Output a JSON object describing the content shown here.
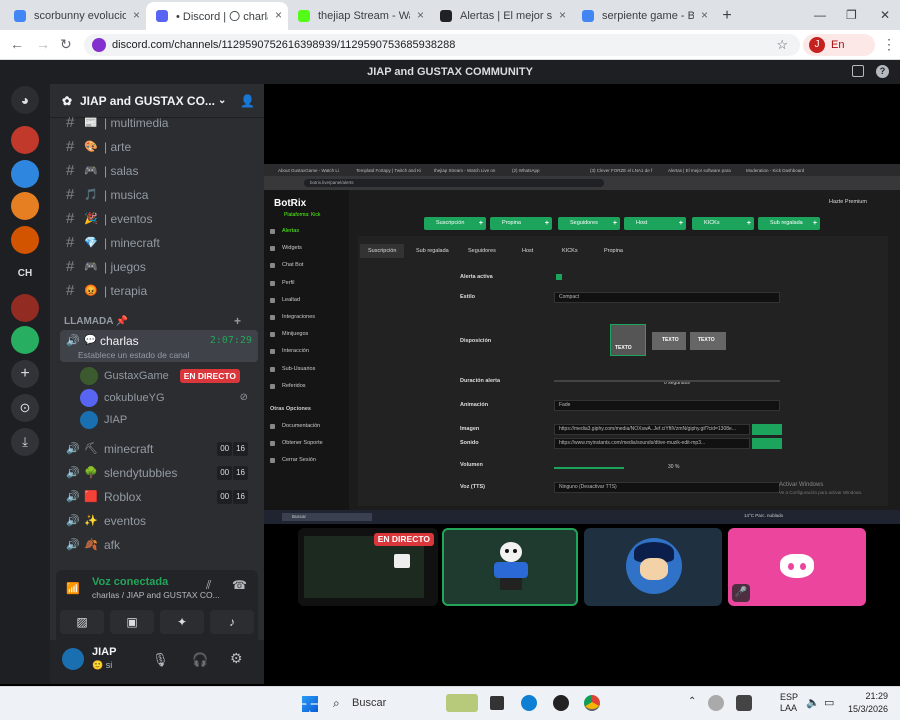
{
  "browser": {
    "tabs": [
      {
        "label": "scorbunny evolucion - Bu",
        "color": "#4285f4",
        "active": false
      },
      {
        "label": "• Discord | 〇 charlas |",
        "color": "#5865f2",
        "active": true
      },
      {
        "label": "thejiap Stream - Watch Li",
        "color": "#53fc18",
        "active": false
      },
      {
        "label": "Alertas | El mejor softwar",
        "color": "#202124",
        "active": false
      },
      {
        "label": "serpiente game - Buscar",
        "color": "#4285f4",
        "active": false
      }
    ],
    "url": "discord.com/channels/1129590752616398939/1129590753685938288",
    "profile_initial": "J",
    "profile_status": "En pausa"
  },
  "discord": {
    "window_title": "JIAP and GUSTAX COMMUNITY",
    "server_name": "JIAP and GUSTAX CO...",
    "text_channels": [
      {
        "emoji": "📰",
        "name": "| multimedia"
      },
      {
        "emoji": "🎨",
        "name": "| arte"
      },
      {
        "emoji": "🎮",
        "name": "| salas"
      },
      {
        "emoji": "🎵",
        "name": "| musica"
      },
      {
        "emoji": "🎉",
        "name": "| eventos"
      },
      {
        "emoji": "💎",
        "name": "| minecraft"
      },
      {
        "emoji": "🎮",
        "name": "| juegos"
      },
      {
        "emoji": "😡",
        "name": "| terapia"
      }
    ],
    "category": "LLAMADA 📌",
    "active_voice": {
      "name": "charlas",
      "time": "2:07:29",
      "status_placeholder": "Establece un estado de canal"
    },
    "voice_users": [
      {
        "name": "GustaxGame",
        "badge": "EN DIRECTO",
        "avatar_color": "#3b5b2e"
      },
      {
        "name": "cokubIueYG",
        "badge": "",
        "avatar_color": "#5865f2"
      },
      {
        "name": "JIAP",
        "badge": "",
        "avatar_color": "#1a6fb0"
      }
    ],
    "voice_channels": [
      {
        "emoji": "⛏",
        "name": "minecraft",
        "count": [
          "00",
          "16"
        ]
      },
      {
        "emoji": "🌳",
        "name": "slendytubbies",
        "count": [
          "00",
          "16"
        ]
      },
      {
        "emoji": "🟥",
        "name": "Roblox",
        "count": [
          "00",
          "16"
        ]
      },
      {
        "emoji": "✨",
        "name": "eventos",
        "count": []
      },
      {
        "emoji": "🍂",
        "name": "afk",
        "count": []
      }
    ],
    "voice_panel": {
      "status": "Voz conectada",
      "channel": "charlas / JIAP and GUSTAX CO..."
    },
    "user": {
      "name": "JIAP",
      "status": "si"
    },
    "participant_badge": "EN DIRECTO"
  },
  "shared_screen": {
    "tabs": [
      "About GustaxGame - Watch Li",
      "Templatd Fortapy | Twitch and Ki",
      "thejiap Stream - Watch Live on",
      "(2) WhatsApp",
      "(3) Clever FORZE el LNA1 de f",
      "Alertas | El mejor software para",
      "Moderation - Kick Dashboard"
    ],
    "url": "botrix.live/panel/alerts",
    "brand": "BotRix",
    "platform": "Plataforma: Kick",
    "premium": "Hazte Premium",
    "sidebar": [
      "Alertas",
      "Widgets",
      "Chat Bot",
      "Perfil",
      "Lealtad",
      "Integraciones",
      "Minijuegos",
      "Interacción",
      "Sub-Usuarios",
      "Referidos"
    ],
    "sidebar_other_title": "Otras Opciones",
    "sidebar_other": [
      "Documentación",
      "Obtener Soporte",
      "Cerrar Sesión"
    ],
    "green_buttons": [
      "Suscripción",
      "Propina",
      "Seguidores",
      "Host",
      "KICKs",
      "Sub regalada"
    ],
    "panel_tabs": [
      "Suscripción",
      "Sub regalada",
      "Seguidores",
      "Host",
      "KICKs",
      "Propina"
    ],
    "fields": [
      {
        "label": "Alerta activa",
        "value": ""
      },
      {
        "label": "Estilo",
        "value": "Compact"
      },
      {
        "label": "Disposición",
        "value": ""
      },
      {
        "label": "Duración alerta",
        "value": "0  segundos"
      },
      {
        "label": "Animación",
        "value": "Fade"
      },
      {
        "label": "Imagen",
        "value": "https://media3.giphy.com/media/NOXswA..Jef.ciYftlVzmN/giphy.gif?cid=1308e..."
      },
      {
        "label": "Sonido",
        "value": "https://www.myinstants.com/media/sounds/dtive-muzik-edit-mp3..."
      },
      {
        "label": "Volumen",
        "value": "30 %"
      },
      {
        "label": "Voz (TTS)",
        "value": "Ninguno (Desactivar TTS)"
      }
    ],
    "layout_options": [
      "TEXTO",
      "TEXTO",
      "TEXTO"
    ],
    "activate_windows": "Activar Windows",
    "activate_windows_sub": "Ve a Configuración para activar Windows.",
    "search": "Buscar",
    "weather": "14°C Parc. nublado"
  },
  "windows": {
    "search_placeholder": "Buscar",
    "lang": "ESP",
    "lang2": "LAA",
    "time": "21:29",
    "date": "15/3/2026"
  }
}
